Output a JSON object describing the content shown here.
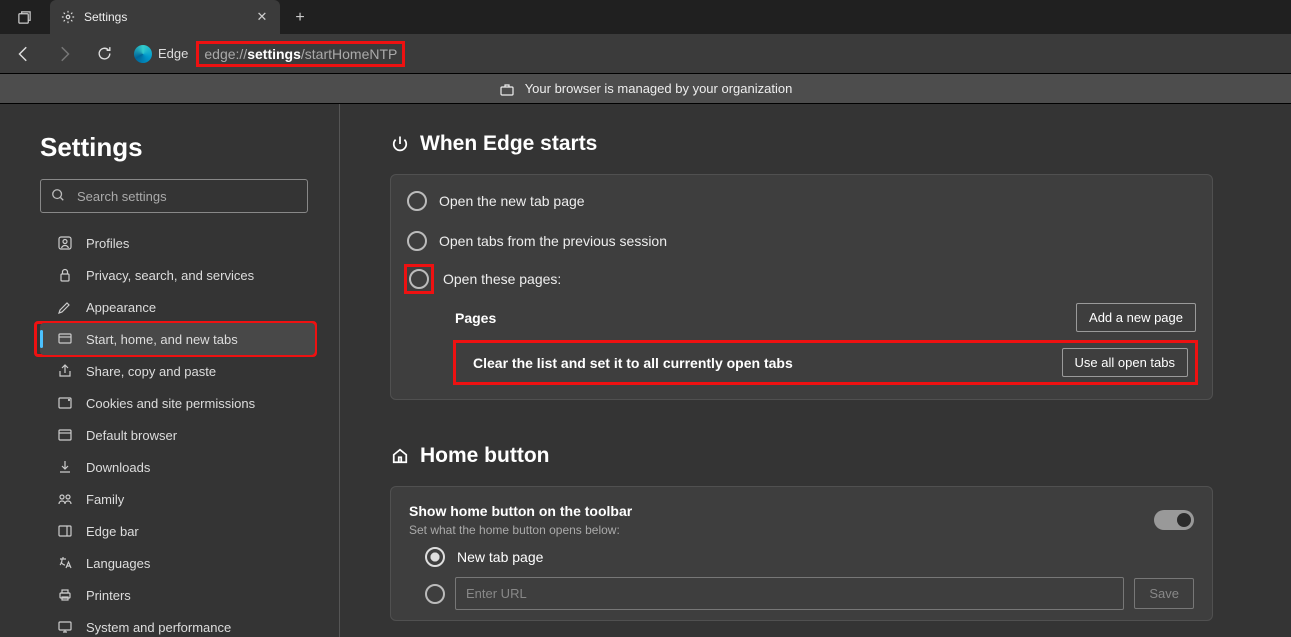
{
  "titlebar": {
    "tab_label": "Settings",
    "url_prefix": "edge://",
    "url_mid": "settings",
    "url_suffix": "/startHomeNTP",
    "edge_label": "Edge"
  },
  "banner": {
    "text": "Your browser is managed by your organization"
  },
  "sidebar": {
    "title": "Settings",
    "search_placeholder": "Search settings",
    "items": [
      {
        "label": "Profiles"
      },
      {
        "label": "Privacy, search, and services"
      },
      {
        "label": "Appearance"
      },
      {
        "label": "Start, home, and new tabs"
      },
      {
        "label": "Share, copy and paste"
      },
      {
        "label": "Cookies and site permissions"
      },
      {
        "label": "Default browser"
      },
      {
        "label": "Downloads"
      },
      {
        "label": "Family"
      },
      {
        "label": "Edge bar"
      },
      {
        "label": "Languages"
      },
      {
        "label": "Printers"
      },
      {
        "label": "System and performance"
      }
    ]
  },
  "main": {
    "starts": {
      "heading": "When Edge starts",
      "opt1": "Open the new tab page",
      "opt2": "Open tabs from the previous session",
      "opt3": "Open these pages:",
      "pages_label": "Pages",
      "add_btn": "Add a new page",
      "clear_label": "Clear the list and set it to all currently open tabs",
      "use_btn": "Use all open tabs"
    },
    "home": {
      "heading": "Home button",
      "toggle_title": "Show home button on the toolbar",
      "toggle_sub": "Set what the home button opens below:",
      "opt_newtab": "New tab page",
      "url_placeholder": "Enter URL",
      "save_btn": "Save"
    }
  }
}
